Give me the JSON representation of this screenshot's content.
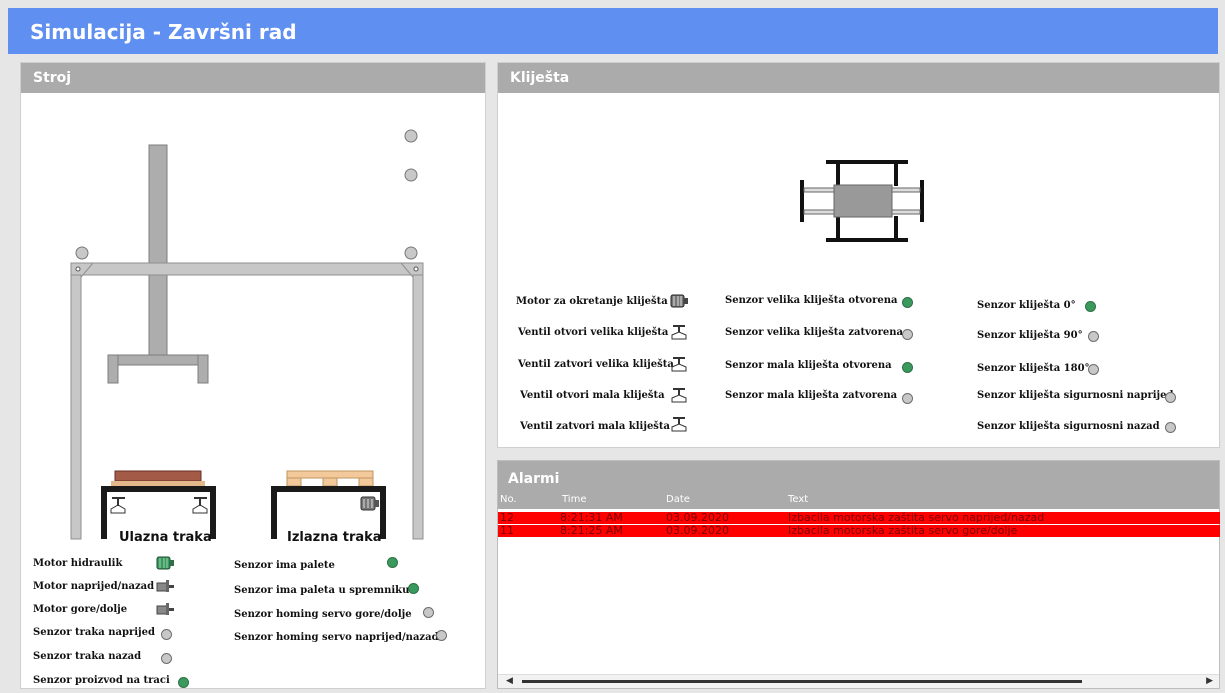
{
  "app": {
    "title": "Simulacija - Završni rad"
  },
  "stroj": {
    "title": "Stroj",
    "ulazna_traka": "Ulazna traka",
    "izlazna_traka": "Izlazna traka",
    "left_items": [
      {
        "label": "Motor hidraulik",
        "indicator": "motor-icon",
        "color": "#3a9a5e"
      },
      {
        "label": "Motor naprijed/nazad",
        "indicator": "servo-motor-icon"
      },
      {
        "label": "Motor gore/dolje",
        "indicator": "servo-motor-icon"
      },
      {
        "label": "Senzor traka naprijed",
        "indicator": "led",
        "state": "off"
      },
      {
        "label": "Senzor traka nazad",
        "indicator": "led",
        "state": "off"
      },
      {
        "label": "Senzor proizvod na traci",
        "indicator": "led",
        "state": "on"
      }
    ],
    "right_items": [
      {
        "label": "Senzor ima palete",
        "state": "on"
      },
      {
        "label": "Senzor ima paleta u spremniku",
        "state": "on"
      },
      {
        "label": "Senzor homing servo gore/dolje",
        "state": "off"
      },
      {
        "label": "Senzor homing servo naprijed/nazad",
        "state": "off"
      }
    ]
  },
  "kljesta": {
    "title": "Kliješta",
    "col1": [
      {
        "label": "Motor za okretanje kliješta",
        "indicator": "motor-icon"
      },
      {
        "label": "Ventil otvori velika kliješta",
        "indicator": "valve-icon"
      },
      {
        "label": "Ventil zatvori velika kliješta",
        "indicator": "valve-icon"
      },
      {
        "label": "Ventil otvori mala kliješta",
        "indicator": "valve-icon"
      },
      {
        "label": "Ventil zatvori mala kliješta",
        "indicator": "valve-icon"
      }
    ],
    "col2": [
      {
        "label": "Senzor velika kliješta otvorena",
        "state": "on"
      },
      {
        "label": "Senzor velika kliješta zatvorena",
        "state": "off"
      },
      {
        "label": "Senzor mala kliješta otvorena",
        "state": "on"
      },
      {
        "label": "Senzor mala kliješta zatvorena",
        "state": "off"
      }
    ],
    "col3": [
      {
        "label": "Senzor kliješta 0°",
        "state": "on"
      },
      {
        "label": "Senzor kliješta 90°",
        "state": "off"
      },
      {
        "label": "Senzor kliješta 180°",
        "state": "off"
      },
      {
        "label": "Senzor kliješta sigurnosni naprijed",
        "state": "off"
      },
      {
        "label": "Senzor kliješta sigurnosni nazad",
        "state": "off"
      }
    ]
  },
  "alarmi": {
    "title": "Alarmi",
    "headers": {
      "no": "No.",
      "time": "Time",
      "date": "Date",
      "text": "Text"
    },
    "rows": [
      {
        "no": "12",
        "time": "8:21:31 AM",
        "date": "03.09.2020",
        "text": "Izbacila motorska zaštita servo naprijed/nazad"
      },
      {
        "no": "11",
        "time": "8:21:25 AM",
        "date": "03.09.2020",
        "text": "Izbacila motorska zaštita servo gore/dolje"
      }
    ],
    "row_color": "#ff0000"
  },
  "colors": {
    "titlebar": "#5f8ff0",
    "header": "#ababab",
    "led_on": "#3a9a5e",
    "led_off": "#c8c8c8"
  }
}
